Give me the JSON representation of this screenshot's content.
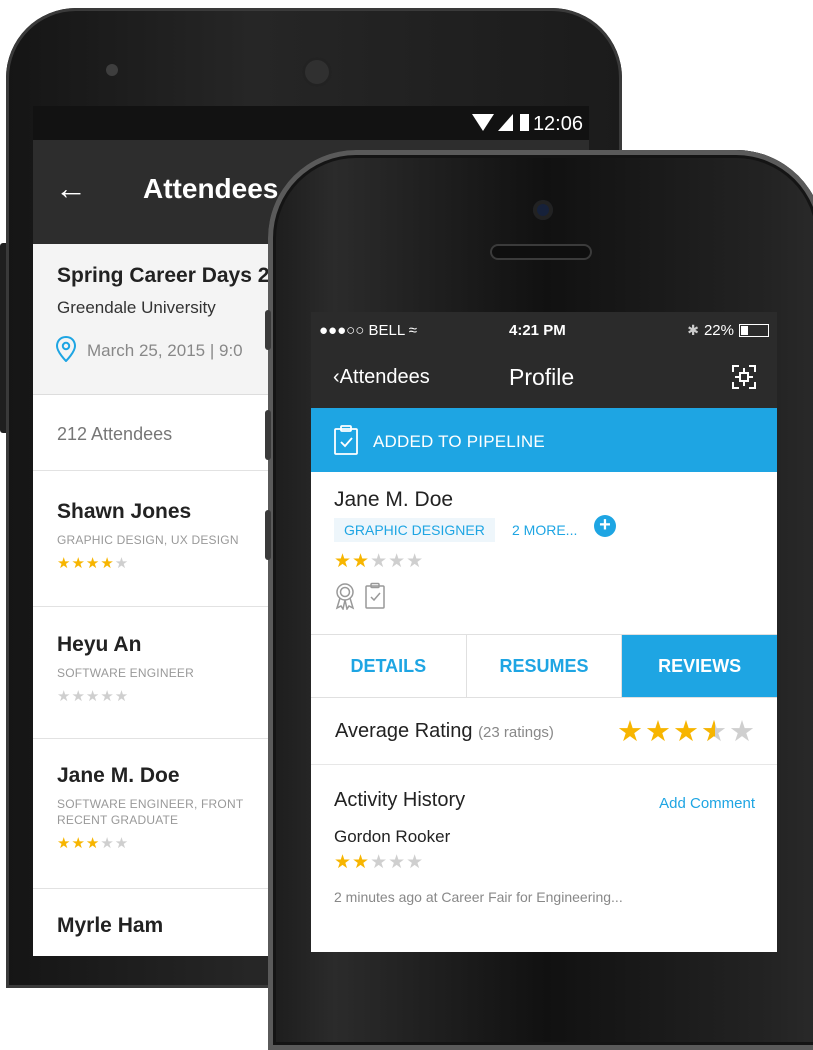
{
  "android": {
    "status": {
      "time": "12:06"
    },
    "toolbar": {
      "title": "Attendees"
    },
    "event": {
      "title": "Spring Career Days 2",
      "university": "Greendale University",
      "date": "March 25, 2015 | 9:0"
    },
    "attendee_count": "212 Attendees",
    "attendees": [
      {
        "name": "Shawn Jones",
        "role": "GRAPHIC DESIGN, UX DESIGN",
        "role2": "",
        "rating": 4
      },
      {
        "name": "Heyu An",
        "role": "SOFTWARE ENGINEER",
        "role2": "",
        "rating": 0
      },
      {
        "name": "Jane M. Doe",
        "role": "SOFTWARE ENGINEER, FRONT",
        "role2": "RECENT GRADUATE",
        "rating": 3
      },
      {
        "name": "Myrle Ham",
        "role": "",
        "role2": "",
        "rating": 0
      }
    ]
  },
  "iphone": {
    "status": {
      "carrier": "●●●○○ BELL",
      "time": "4:21 PM",
      "battery": "22%"
    },
    "nav": {
      "back_label": "Attendees",
      "title": "Profile"
    },
    "banner": {
      "text": "ADDED TO PIPELINE"
    },
    "profile": {
      "name": "Jane M. Doe",
      "tag": "GRAPHIC DESIGNER",
      "more": "2 MORE...",
      "rating": 2
    },
    "tabs": [
      {
        "label": "DETAILS",
        "active": false
      },
      {
        "label": "RESUMES",
        "active": false
      },
      {
        "label": "REVIEWS",
        "active": true
      }
    ],
    "average": {
      "label": "Average Rating",
      "count": "(23 ratings)",
      "rating": 3.5
    },
    "activity": {
      "heading": "Activity History",
      "add_label": "Add Comment",
      "reviewer": "Gordon Rooker",
      "rating": 2,
      "meta": "2 minutes ago at Career Fair for Engineering..."
    }
  },
  "colors": {
    "accent": "#1ea5e3",
    "star": "#f7b500",
    "toolbar": "#2d2d2d"
  }
}
